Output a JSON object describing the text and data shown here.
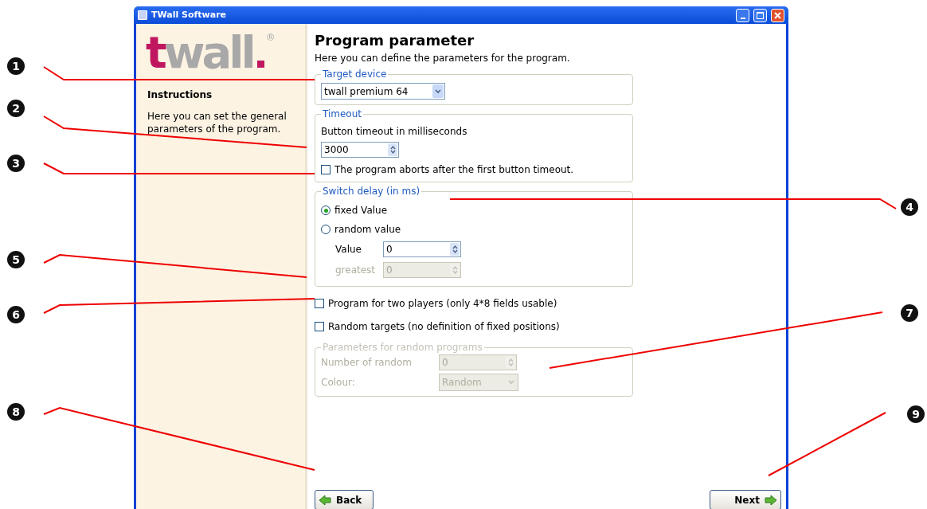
{
  "window": {
    "title": "TWall Software"
  },
  "logo": {
    "text": "twall",
    "mark": "®"
  },
  "sidebar": {
    "heading": "Instructions",
    "text": "Here you can set the general parameters of the program."
  },
  "page": {
    "title": "Program parameter",
    "subtitle": "Here you can define the parameters for the program."
  },
  "target_device": {
    "legend": "Target device",
    "value": "twall premium 64"
  },
  "timeout": {
    "legend": "Timeout",
    "label": "Button timeout in milliseconds",
    "value": "3000",
    "abort": {
      "label": "The program aborts after the first button timeout.",
      "checked": false
    }
  },
  "switch_delay": {
    "legend": "Switch delay (in ms)",
    "options": [
      {
        "label": "fixed Value",
        "selected": true
      },
      {
        "label": "random value",
        "selected": false
      }
    ],
    "fields": [
      {
        "label": "Value",
        "value": "0",
        "disabled": false
      },
      {
        "label": "greatest",
        "value": "0",
        "disabled": true
      }
    ]
  },
  "options": [
    {
      "label": "Program for two players (only 4*8 fields usable)",
      "checked": false
    },
    {
      "label": "Random targets (no definition of fixed positions)",
      "checked": false
    }
  ],
  "random_params": {
    "legend": "Parameters for random programs",
    "disabled": true,
    "number": {
      "label": "Number of random",
      "value": "0"
    },
    "colour": {
      "label": "Colour:",
      "value": "Random"
    }
  },
  "buttons": {
    "back": "Back",
    "next": "Next"
  },
  "callouts": [
    {
      "number": "1"
    },
    {
      "number": "2"
    },
    {
      "number": "3"
    },
    {
      "number": "4"
    },
    {
      "number": "5"
    },
    {
      "number": "6"
    },
    {
      "number": "7"
    },
    {
      "number": "8"
    },
    {
      "number": "9"
    }
  ]
}
